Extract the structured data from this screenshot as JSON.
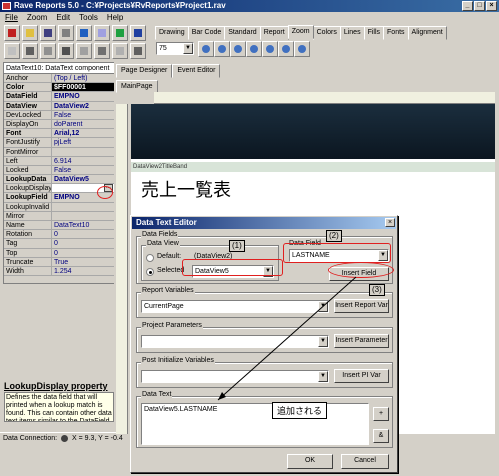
{
  "window": {
    "title": "Rave Reports 5.0 - C:¥Projects¥RvReports¥Project1.rav"
  },
  "menu": [
    "File",
    "Zoom",
    "Edit",
    "Tools",
    "Help"
  ],
  "component_tabs": [
    "Drawing",
    "Bar Code",
    "Standard",
    "Report",
    "Zoom",
    "Colors",
    "Lines",
    "Fills",
    "Fonts",
    "Alignment"
  ],
  "zoom_value": "75",
  "inspector": {
    "header": "DataText10: DataText component",
    "props": [
      {
        "k": "Anchor",
        "v": "(Top / Left)"
      },
      {
        "k": "Color",
        "v": "$FF00001"
      },
      {
        "k": "DataField",
        "v": "EMPNO"
      },
      {
        "k": "DataView",
        "v": "DataView2"
      },
      {
        "k": "DevLocked",
        "v": "False"
      },
      {
        "k": "DisplayOn",
        "v": "doParent"
      },
      {
        "k": "Font",
        "v": "Arial,12"
      },
      {
        "k": "FontJustify",
        "v": "pjLeft"
      },
      {
        "k": "FontMirror",
        "v": ""
      },
      {
        "k": "Left",
        "v": "6.914"
      },
      {
        "k": "Locked",
        "v": "False"
      },
      {
        "k": "LookupData",
        "v": "DataView5"
      },
      {
        "k": "LookupDisplay",
        "v": ""
      },
      {
        "k": "LookupField",
        "v": "EMPNO"
      },
      {
        "k": "LookupInvalid",
        "v": ""
      },
      {
        "k": "Mirror",
        "v": ""
      },
      {
        "k": "Name",
        "v": "DataText10"
      },
      {
        "k": "Rotation",
        "v": "0"
      },
      {
        "k": "Tag",
        "v": "0"
      },
      {
        "k": "Top",
        "v": "0"
      },
      {
        "k": "Truncate",
        "v": "True"
      },
      {
        "k": "Width",
        "v": "1.254"
      }
    ]
  },
  "help": {
    "title": "LookupDisplay property",
    "text": "Defines the data field that will printed when a lookup match is found. This can contain other data text items similar to the DataField property."
  },
  "status": {
    "label": "Data Connection:",
    "coords": "X = 9.3, Y = -0.4"
  },
  "designer": {
    "tabs": [
      "Page Designer",
      "Event Editor"
    ],
    "page_tab": "MainPage",
    "band_label": "DataView2TitleBand",
    "report_title": "売上一覧表"
  },
  "dialog": {
    "title": "Data Text Editor",
    "data_fields_label": "Data Fields",
    "data_view_label": "Data View",
    "default_label": "Default:",
    "default_value": "(DataView2)",
    "selected_label": "Selected",
    "selected_value": "DataView5",
    "data_field_label": "Data Field",
    "data_field_value": "LASTNAME",
    "insert_field": "Insert Field",
    "report_vars_label": "Report Variables",
    "report_vars_value": "CurrentPage",
    "insert_report_var": "Insert Report Var",
    "project_params_label": "Project Parameters",
    "insert_parameter": "Insert Parameter",
    "post_init_label": "Post Initialize Variables",
    "insert_pi_var": "Insert PI Var",
    "data_text_label": "Data Text",
    "data_text_value": "DataView5.LASTNAME",
    "plus_btn": "+",
    "amp_btn": "&",
    "ok": "OK",
    "cancel": "Cancel"
  },
  "annotations": {
    "one": "(1)",
    "two": "(2)",
    "three": "(3)",
    "added_note": "追加される"
  },
  "accent": "#e02020"
}
